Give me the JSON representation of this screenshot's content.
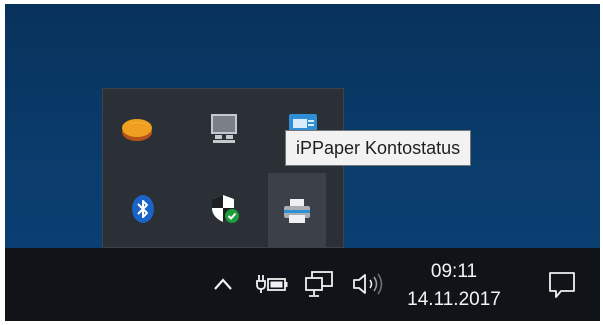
{
  "tooltip": {
    "text": "iPPaper Kontostatus"
  },
  "tray_icons": [
    {
      "name": "app-disc-icon",
      "color": "#e87a1e"
    },
    {
      "name": "network-adapter-icon",
      "color": "#b8bcc2"
    },
    {
      "name": "ippaper-account-icon",
      "color": "#2f8fd6"
    },
    {
      "name": "bluetooth-icon",
      "color": "#1b63c6"
    },
    {
      "name": "windows-defender-shield-icon",
      "color": "#1e9e3a"
    },
    {
      "name": "printer-icon",
      "color": "#cfd3d8"
    }
  ],
  "taskbar": {
    "clock_time": "09:11",
    "clock_date": "14.11.2017",
    "icons": [
      "show-hidden-icons-chevron-icon",
      "battery-charging-icon",
      "network-wired-icon",
      "volume-icon",
      "action-center-icon"
    ]
  }
}
